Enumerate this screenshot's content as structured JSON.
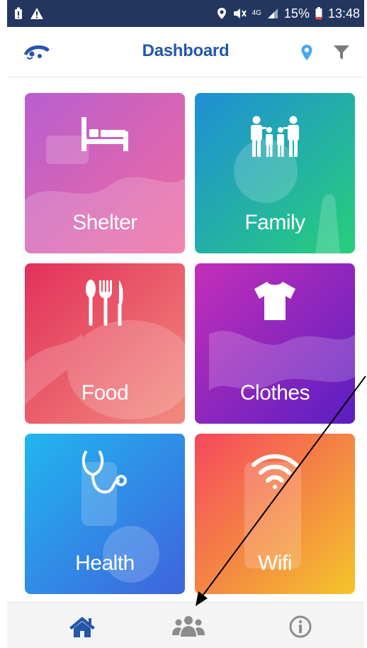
{
  "status_bar": {
    "network": "4G",
    "battery": "15%",
    "time": "13:48"
  },
  "header": {
    "title": "Dashboard"
  },
  "tiles": [
    {
      "label": "Shelter",
      "icon": "bed-icon",
      "color_from": "#b95ecf",
      "color_to": "#f06b9e"
    },
    {
      "label": "Family",
      "icon": "family-icon",
      "color_from": "#1f8ed6",
      "color_to": "#27cf7a"
    },
    {
      "label": "Food",
      "icon": "cutlery-icon",
      "color_from": "#e2315a",
      "color_to": "#f28a7d"
    },
    {
      "label": "Clothes",
      "icon": "tshirt-icon",
      "color_from": "#c42fb8",
      "color_to": "#5a1ec2"
    },
    {
      "label": "Health",
      "icon": "stethoscope-icon",
      "color_from": "#21b6f0",
      "color_to": "#3f63dd"
    },
    {
      "label": "Wifi",
      "icon": "wifi-icon",
      "color_from": "#f5475e",
      "color_to": "#f4c42a"
    }
  ],
  "bottom_nav": [
    {
      "name": "home",
      "icon": "home-icon",
      "color": "#2457a8"
    },
    {
      "name": "people",
      "icon": "people-icon",
      "color": "#8c8c8c"
    },
    {
      "name": "info",
      "icon": "info-icon",
      "color": "#8c8c8c"
    }
  ],
  "colors": {
    "status_bar": "#22365e",
    "brand": "#2457a8",
    "pin": "#45a8f0"
  }
}
